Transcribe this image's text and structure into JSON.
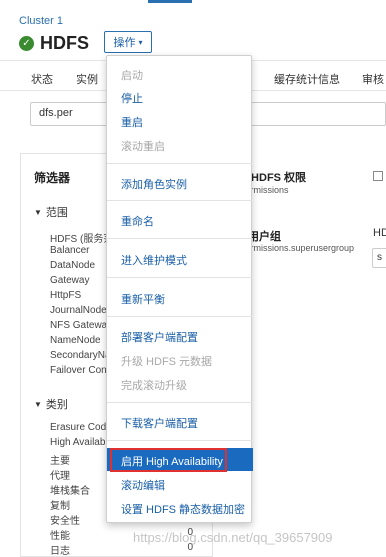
{
  "header": {
    "cluster": "Cluster 1",
    "service_name": "HDFS",
    "actions_label": "操作"
  },
  "tabs": [
    {
      "label": "状态"
    },
    {
      "label": "实例"
    },
    {
      "label": "缓存统计信息"
    },
    {
      "label": "审核"
    }
  ],
  "search": {
    "value": "dfs.per"
  },
  "filters": {
    "title": "筛选器",
    "scope": {
      "label": "范围",
      "items": [
        "HDFS (服务范围)",
        "Balancer",
        "DataNode",
        "Gateway",
        "HttpFS",
        "JournalNode",
        "NFS Gateway",
        "NameNode",
        "SecondaryNameNode",
        "Failover Controller"
      ]
    },
    "category": {
      "label": "类别",
      "items": [
        {
          "name": "Erasure Coding",
          "count": ""
        },
        {
          "name": "High Availability",
          "count": ""
        },
        {
          "name": "主要",
          "count": ""
        },
        {
          "name": "代理",
          "count": ""
        },
        {
          "name": "堆栈集合",
          "count": "0"
        },
        {
          "name": "复制",
          "count": "0"
        },
        {
          "name": "安全性",
          "count": "0"
        },
        {
          "name": "性能",
          "count": "0"
        },
        {
          "name": "日志",
          "count": "0"
        }
      ]
    }
  },
  "config": {
    "perm_title": "启用 HDFS 权限",
    "perm_sub": "dfs.permissions",
    "group_title": "超级用户组",
    "group_sub": "dfs.permissions.superusergroup",
    "hd_label": "HD",
    "select_value": "s"
  },
  "menu": {
    "start": "启动",
    "stop": "停止",
    "restart": "重启",
    "rolling_restart": "滚动重启",
    "add_role": "添加角色实例",
    "rename": "重命名",
    "maintenance": "进入维护模式",
    "rebalance": "重新平衡",
    "deploy_client": "部署客户端配置",
    "upgrade_metadata": "升级 HDFS 元数据",
    "finalize_upgrade": "完成滚动升级",
    "download_client": "下载客户端配置",
    "enable_ha": "启用 High Availability",
    "rolling_edit": "滚动编辑",
    "encryption": "设置 HDFS 静态数据加密"
  },
  "colors": {
    "accent": "#1a5fa8",
    "highlight": "#1a6ac0",
    "annotation_red": "#e03030",
    "status_green": "#3a8a2f"
  },
  "watermark": "https://blog.csdn.net/qq_39657909"
}
